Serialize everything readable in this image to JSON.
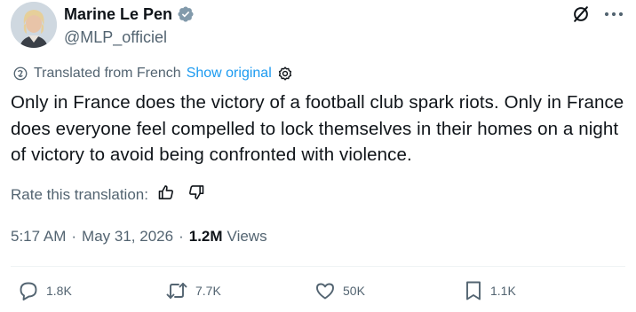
{
  "author": {
    "name": "Marine Le Pen",
    "handle": "@MLP_officiel",
    "verified_color": "#829aab"
  },
  "translation": {
    "label": "Translated from French",
    "show_original": "Show original"
  },
  "tweet": {
    "text": "Only in France does the victory of a football club spark riots. Only in France does everyone feel compelled to lock themselves in their homes on a night of victory to avoid being confronted with violence."
  },
  "rate": {
    "label": "Rate this translation:"
  },
  "meta": {
    "time": "5:17 AM",
    "separator": "·",
    "date": "May 31, 2026",
    "views_count": "1.2M",
    "views_label": "Views"
  },
  "actions": {
    "replies": "1.8K",
    "reposts": "7.7K",
    "likes": "50K",
    "bookmarks": "1.1K"
  },
  "colors": {
    "link": "#1d9bf0",
    "secondary_text": "#536471",
    "primary_text": "#0f1419"
  }
}
